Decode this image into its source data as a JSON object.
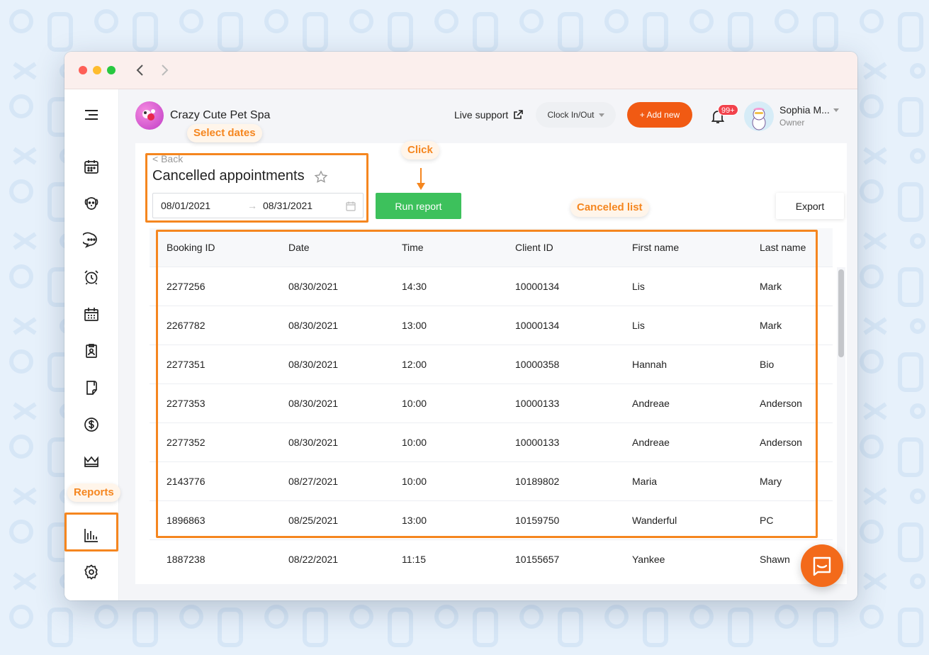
{
  "header": {
    "shop_name": "Crazy Cute Pet Spa",
    "live_support": "Live support",
    "clock_label": "Clock In/Out",
    "add_new": "+ Add new",
    "notif_badge": "99+",
    "user_name": "Sophia M...",
    "user_role": "Owner"
  },
  "report": {
    "back": "< Back",
    "title": "Cancelled appointments",
    "date_start": "08/01/2021",
    "date_end": "08/31/2021",
    "run_report": "Run report",
    "export": "Export"
  },
  "table": {
    "columns": [
      "Booking ID",
      "Date",
      "Time",
      "Client ID",
      "First name",
      "Last name"
    ],
    "rows": [
      [
        "2277256",
        "08/30/2021",
        "14:30",
        "10000134",
        "Lis",
        "Mark"
      ],
      [
        "2267782",
        "08/30/2021",
        "13:00",
        "10000134",
        "Lis",
        "Mark"
      ],
      [
        "2277351",
        "08/30/2021",
        "12:00",
        "10000358",
        "Hannah",
        "Bio"
      ],
      [
        "2277353",
        "08/30/2021",
        "10:00",
        "10000133",
        "Andreae",
        "Anderson"
      ],
      [
        "2277352",
        "08/30/2021",
        "10:00",
        "10000133",
        "Andreae",
        "Anderson"
      ],
      [
        "2143776",
        "08/27/2021",
        "10:00",
        "10189802",
        "Maria",
        "Mary"
      ],
      [
        "1896863",
        "08/25/2021",
        "13:00",
        "10159750",
        "Wanderful",
        "PC"
      ],
      [
        "1887238",
        "08/22/2021",
        "11:15",
        "10155657",
        "Yankee",
        "Shawn"
      ]
    ]
  },
  "annotations": {
    "select_dates": "Select dates",
    "click": "Click",
    "canceled_list": "Canceled list",
    "reports": "Reports"
  },
  "sidebar": {
    "icons": [
      "menu-icon",
      "calendar-icon",
      "pet-icon",
      "chat-icon",
      "alarm-icon",
      "schedule-icon",
      "client-card-icon",
      "document-icon",
      "dollar-icon",
      "crown-icon",
      "reports-icon",
      "settings-icon"
    ]
  },
  "colors": {
    "accent_orange": "#f15a13",
    "run_green": "#3dc15c",
    "annotation_orange": "#f5861f"
  }
}
